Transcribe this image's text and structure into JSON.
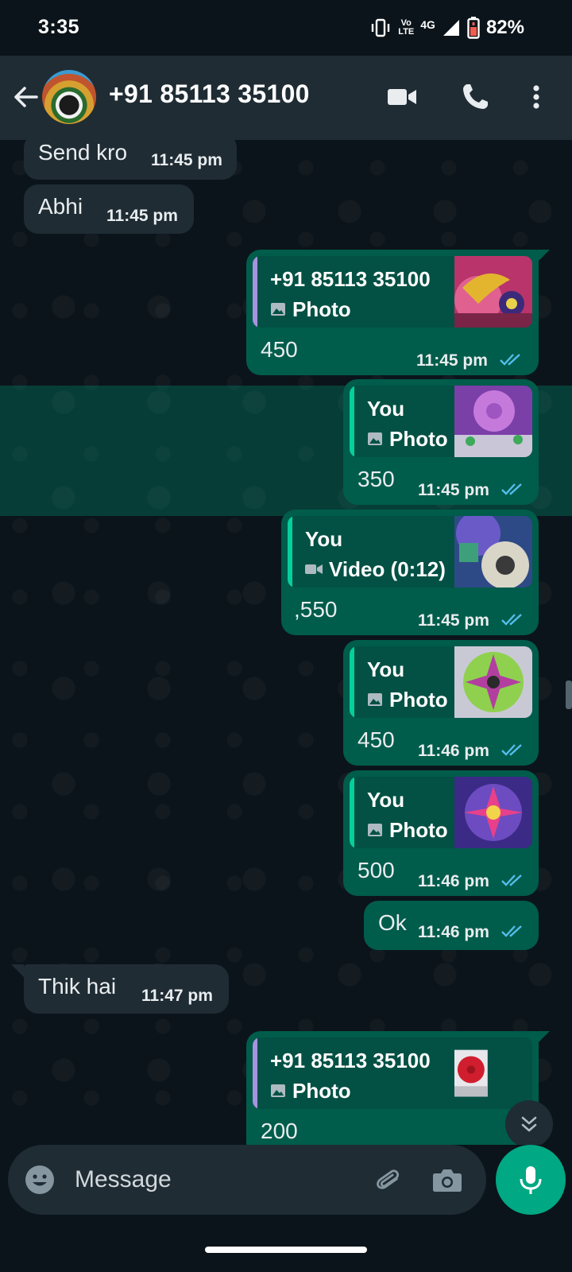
{
  "status_bar": {
    "time": "3:35",
    "volte_top": "Vo",
    "volte_bottom": "LTE",
    "network": "4G",
    "battery": "82%"
  },
  "header": {
    "contact_name": "+91 85113 35100",
    "icons": [
      "back-arrow-icon",
      "video-call-icon",
      "voice-call-icon",
      "more-options-icon"
    ]
  },
  "colors": {
    "incoming_bubble": "#1F2C34",
    "outgoing_bubble": "#005C4B",
    "quote_bg": "#025144",
    "read_tick": "#53BDEB",
    "accent": "#00A884",
    "quote_bar_contact": "#A793E0",
    "quote_bar_self": "#06CF9C"
  },
  "messages": [
    {
      "direction": "in",
      "text": "Send kro",
      "time": "11:45 pm"
    },
    {
      "direction": "in",
      "text": "Abhi",
      "time": "11:45 pm"
    },
    {
      "direction": "out",
      "quote_sender": "+91 85113 35100",
      "quote_type": "Photo",
      "text": "450",
      "time": "11:45 pm",
      "status": "read"
    },
    {
      "direction": "out",
      "quote_sender": "You",
      "quote_type": "Photo",
      "text": "350",
      "time": "11:45 pm",
      "status": "read",
      "highlighted": true
    },
    {
      "direction": "out",
      "quote_sender": "You",
      "quote_type": "Video (0:12)",
      "text": ",550",
      "time": "11:45 pm",
      "status": "read"
    },
    {
      "direction": "out",
      "quote_sender": "You",
      "quote_type": "Photo",
      "text": "450",
      "time": "11:46 pm",
      "status": "read"
    },
    {
      "direction": "out",
      "quote_sender": "You",
      "quote_type": "Photo",
      "text": "500",
      "time": "11:46 pm",
      "status": "read"
    },
    {
      "direction": "out",
      "text": "Ok",
      "time": "11:46 pm",
      "status": "read"
    },
    {
      "direction": "in",
      "text": "Thik hai",
      "time": "11:47 pm"
    },
    {
      "direction": "out",
      "quote_sender": "+91 85113 35100",
      "quote_type": "Photo",
      "text": "200",
      "partially_visible": true
    }
  ],
  "input": {
    "placeholder": "Message",
    "icons": [
      "emoji-icon",
      "attach-icon",
      "camera-icon",
      "mic-icon"
    ]
  }
}
